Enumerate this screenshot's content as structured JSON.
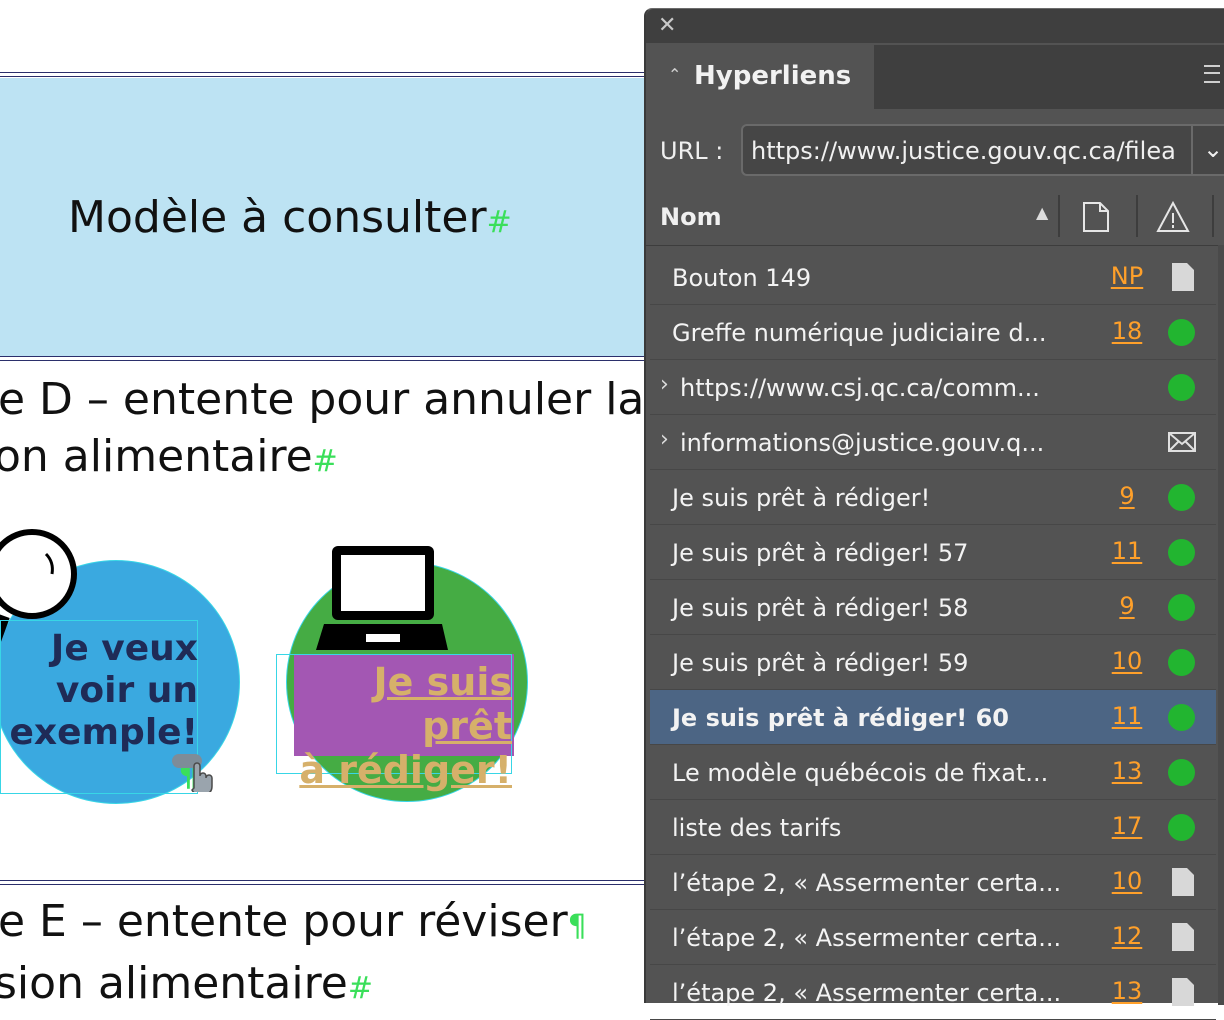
{
  "document": {
    "cell_title": "Modèle à consulter",
    "heading_d_line1": "e D – entente pour annuler la",
    "heading_d_line2": "on alimentaire",
    "heading_e_line1": "e E – entente pour réviser",
    "heading_e_line2": "sion alimentaire",
    "btn_example_l1": "Je veux",
    "btn_example_l2": "voir un",
    "btn_example_l3": "exemple!",
    "btn_ready_l1": "Je suis prêt",
    "btn_ready_l2": "à rédiger!",
    "colors": {
      "cell_bg": "#bde3f3",
      "circle_blue": "#3aa9e0",
      "circle_green": "#45ac44",
      "highlight_purple": "#a357b3",
      "text_navy": "#1f2b57",
      "text_tan": "#d6b06a"
    }
  },
  "panel": {
    "title": "Hyperliens",
    "url_label": "URL :",
    "url_value": "https://www.justice.gouv.qc.ca/filea",
    "column_name": "Nom",
    "rows": [
      {
        "name": "Bouton 149",
        "page": "NP",
        "status": "doc",
        "expand": false,
        "selected": false
      },
      {
        "name": "Greffe numérique judiciaire d...",
        "page": "18",
        "status": "ok",
        "expand": false,
        "selected": false
      },
      {
        "name": "https://www.csj.qc.ca/comm...",
        "page": "",
        "status": "ok",
        "expand": true,
        "selected": false
      },
      {
        "name": "informations@justice.gouv.q...",
        "page": "",
        "status": "mail",
        "expand": true,
        "selected": false
      },
      {
        "name": "Je suis prêt  à rédiger!",
        "page": "9",
        "status": "ok",
        "expand": false,
        "selected": false
      },
      {
        "name": "Je suis prêt  à rédiger! 57",
        "page": "11",
        "status": "ok",
        "expand": false,
        "selected": false
      },
      {
        "name": "Je suis prêt  à rédiger! 58",
        "page": "9",
        "status": "ok",
        "expand": false,
        "selected": false
      },
      {
        "name": "Je suis prêt  à rédiger! 59",
        "page": "10",
        "status": "ok",
        "expand": false,
        "selected": false
      },
      {
        "name": "Je suis prêt  à rédiger! 60",
        "page": "11",
        "status": "ok",
        "expand": false,
        "selected": true
      },
      {
        "name": "Le modèle québécois de fixat...",
        "page": "13",
        "status": "ok",
        "expand": false,
        "selected": false
      },
      {
        "name": "liste des tarifs",
        "page": "17",
        "status": "ok",
        "expand": false,
        "selected": false
      },
      {
        "name": "l’étape 2, « Assermenter certa...",
        "page": "10",
        "status": "doc",
        "expand": false,
        "selected": false
      },
      {
        "name": "l’étape 2, « Assermenter certa...",
        "page": "12",
        "status": "doc",
        "expand": false,
        "selected": false
      },
      {
        "name": "l’étape 2, « Assermenter certa...",
        "page": "13",
        "status": "doc",
        "expand": false,
        "selected": false
      }
    ],
    "colors": {
      "panel_bg": "#535353",
      "selected_row": "#4c6584",
      "page_link": "#ffa02a",
      "status_ok": "#22b530"
    }
  }
}
